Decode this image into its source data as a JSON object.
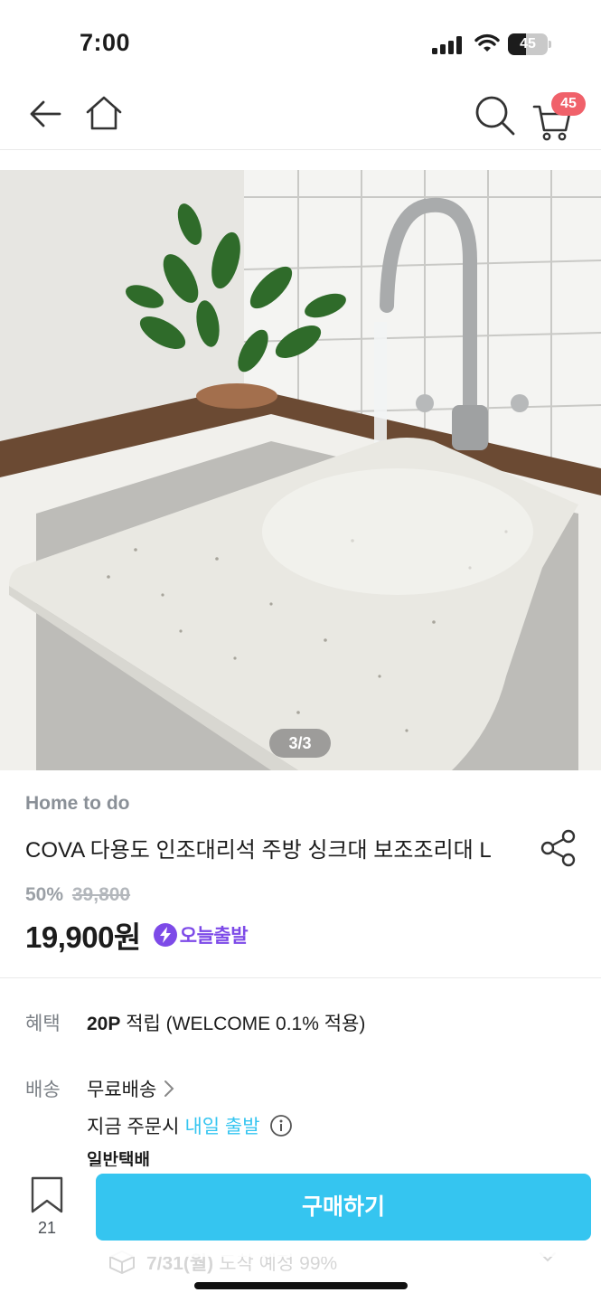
{
  "status_bar": {
    "time": "7:00",
    "battery_level": "45",
    "battery_fraction": 0.45
  },
  "header": {
    "icons": [
      "back-arrow-icon",
      "home-icon",
      "search-icon",
      "cart-icon"
    ],
    "cart_count": "45"
  },
  "gallery": {
    "counter": "3/3"
  },
  "product": {
    "brand": "Home to do",
    "title": "COVA 다용도 인조대리석 주방 싱크대 보조조리대 L",
    "discount_rate": "50%",
    "original_price": "39,800",
    "sale_price": "19,900원",
    "shipping_badge": "오늘출발"
  },
  "benefit": {
    "label": "혜택",
    "points": "20P",
    "text": " 적립 (WELCOME 0.1% 적용)"
  },
  "delivery": {
    "label": "배송",
    "free_shipping": "무료배송",
    "order_prefix": "지금 주문시",
    "departure": "내일 출발",
    "carrier": "일반택배",
    "arrival_date": "7/31(월)",
    "arrival_text": "도착 예정 99%"
  },
  "bottom_bar": {
    "bookmark_count": "21",
    "buy_label": "구매하기"
  },
  "colors": {
    "accent": "#35c5f0",
    "badge": "#f0616a",
    "express": "#7d4ae8"
  }
}
